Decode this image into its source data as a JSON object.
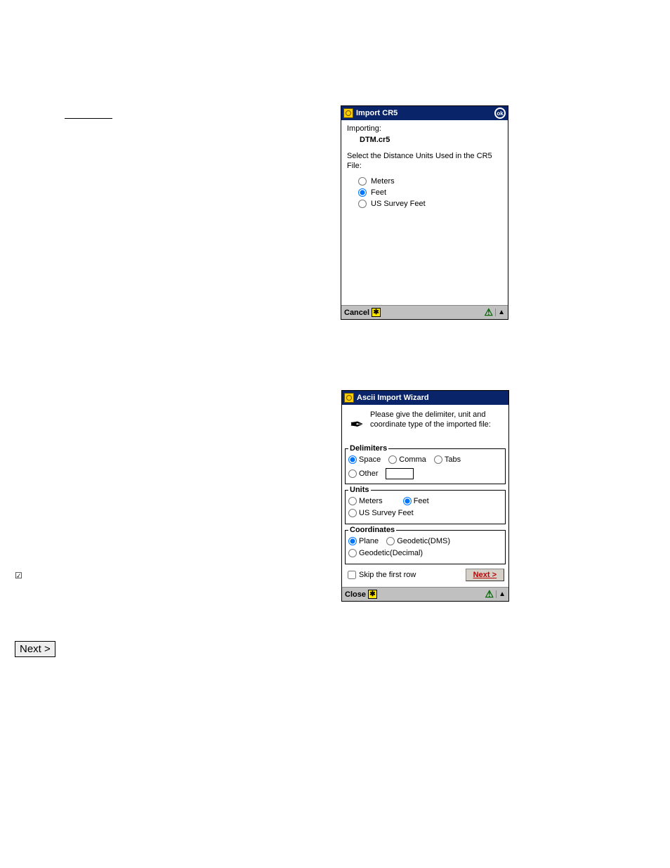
{
  "underline_mark": "",
  "checkbox_glyph": "☑",
  "outer_next_label": "Next >",
  "dialog1": {
    "title": "Import CR5",
    "ok_label": "ok",
    "importing_label": "Importing:",
    "filename": "DTM.cr5",
    "instruction": "Select the Distance Units Used in the CR5 File:",
    "radios": {
      "meters": "Meters",
      "feet": "Feet",
      "us_survey_feet": "US Survey Feet"
    },
    "selected": "feet",
    "cancel_label": "Cancel",
    "sip_glyph": "✱"
  },
  "dialog2": {
    "title": "Ascii Import Wizard",
    "description": "Please give the delimiter, unit and coordinate type of the imported file:",
    "delimiters": {
      "legend": "Delimiters",
      "space": "Space",
      "comma": "Comma",
      "tabs": "Tabs",
      "other": "Other",
      "other_value": "",
      "selected": "space"
    },
    "units": {
      "legend": "Units",
      "meters": "Meters",
      "feet": "Feet",
      "us_survey_feet": "US Survey Feet",
      "selected": "feet"
    },
    "coordinates": {
      "legend": "Coordinates",
      "plane": "Plane",
      "geodetic_dms": "Geodetic(DMS)",
      "geodetic_decimal": "Geodetic(Decimal)",
      "selected": "plane"
    },
    "skip_first_row_label": "Skip the first row",
    "skip_first_row_checked": false,
    "next_label": "Next >",
    "close_label": "Close",
    "sip_glyph": "✱"
  }
}
